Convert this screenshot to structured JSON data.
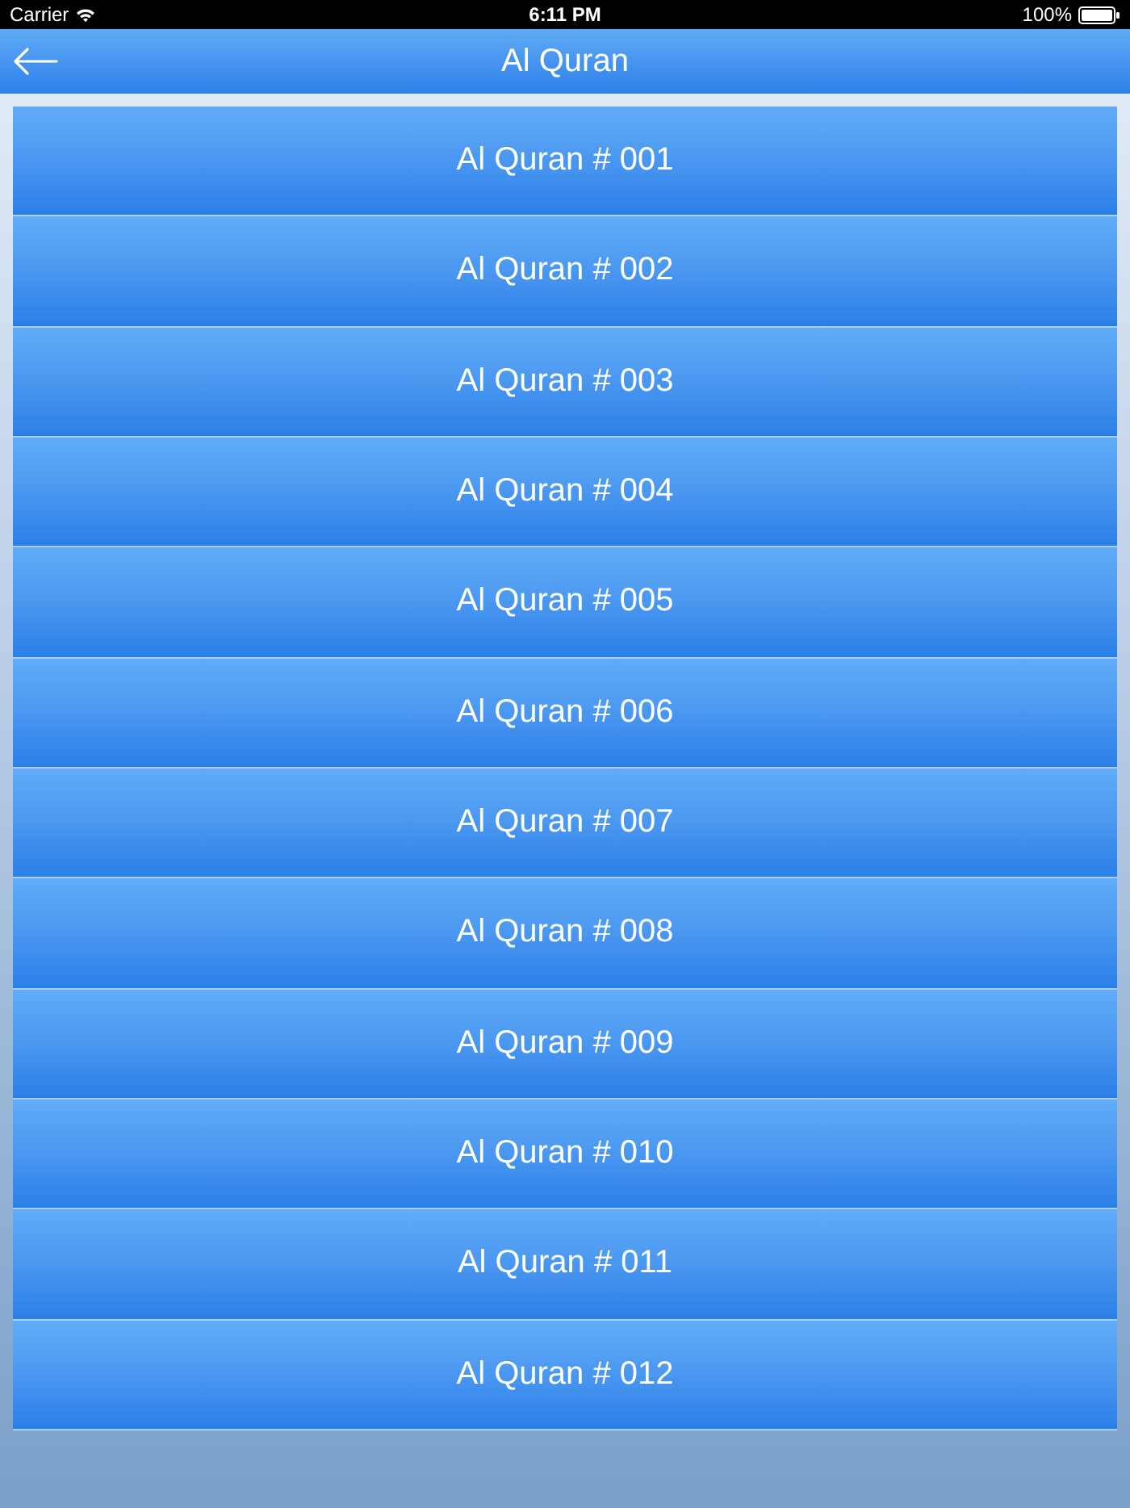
{
  "status_bar": {
    "carrier": "Carrier",
    "time": "6:11 PM",
    "battery": "100%"
  },
  "nav_bar": {
    "title": "Al Quran"
  },
  "items": [
    {
      "label": "Al Quran # 001"
    },
    {
      "label": "Al Quran # 002"
    },
    {
      "label": "Al Quran # 003"
    },
    {
      "label": "Al Quran # 004"
    },
    {
      "label": "Al Quran # 005"
    },
    {
      "label": "Al Quran # 006"
    },
    {
      "label": "Al Quran # 007"
    },
    {
      "label": "Al Quran # 008"
    },
    {
      "label": "Al Quran # 009"
    },
    {
      "label": "Al Quran # 010"
    },
    {
      "label": "Al Quran # 011"
    },
    {
      "label": "Al Quran # 012"
    }
  ]
}
